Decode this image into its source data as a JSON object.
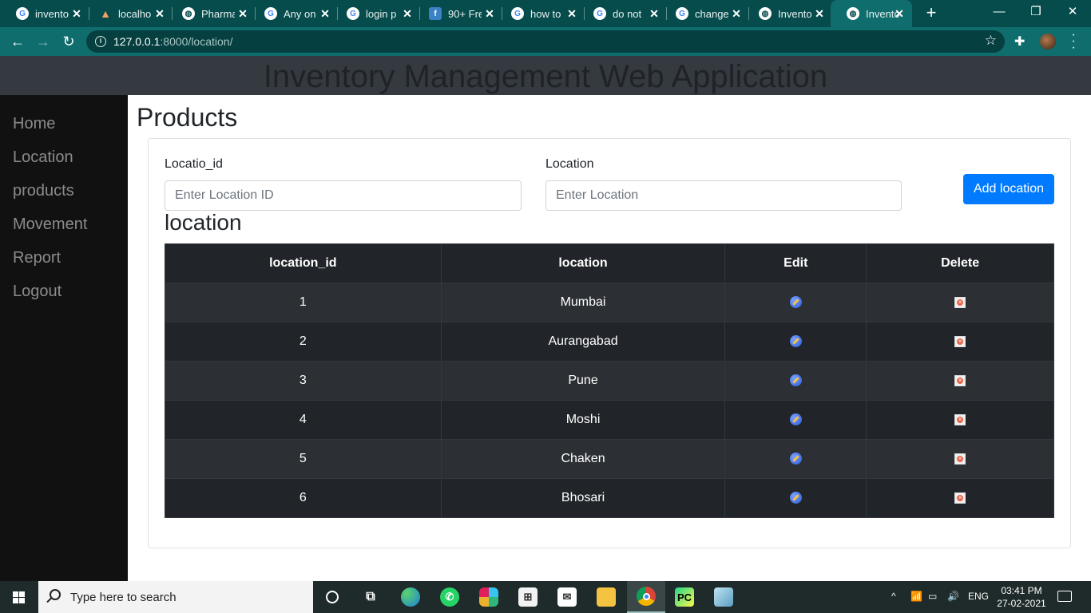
{
  "browser": {
    "tabs": [
      {
        "title": "invento",
        "icon": "google-icon"
      },
      {
        "title": "localho",
        "icon": "xampp-icon"
      },
      {
        "title": "Pharma",
        "icon": "globe-icon"
      },
      {
        "title": "Any on",
        "icon": "google-icon"
      },
      {
        "title": "login p",
        "icon": "google-icon"
      },
      {
        "title": "90+ Fre",
        "icon": "f-icon"
      },
      {
        "title": "how to",
        "icon": "google-icon"
      },
      {
        "title": "do not",
        "icon": "google-icon"
      },
      {
        "title": "change",
        "icon": "google-icon"
      },
      {
        "title": "Invento",
        "icon": "globe-icon"
      },
      {
        "title": "Invento",
        "icon": "globe-icon",
        "active": true
      }
    ],
    "url_host": "127.0.0.1",
    "url_path": ":8000/location/",
    "new_tab_glyph": "+",
    "tab_close_glyph": "✕"
  },
  "app": {
    "header_title": "Inventory Management Web Application",
    "nav": [
      "Home",
      "Location",
      "products",
      "Movement",
      "Report",
      "Logout"
    ],
    "page_title": "Products",
    "form": {
      "id_label": "Locatio_id",
      "id_placeholder": "Enter Location ID",
      "location_label": "Location",
      "location_placeholder": "Enter Location",
      "add_button": "Add location"
    },
    "section_title": "location",
    "table": {
      "headers": [
        "location_id",
        "location",
        "Edit",
        "Delete"
      ],
      "rows": [
        {
          "id": "1",
          "location": "Mumbai"
        },
        {
          "id": "2",
          "location": "Aurangabad"
        },
        {
          "id": "3",
          "location": "Pune"
        },
        {
          "id": "4",
          "location": "Moshi"
        },
        {
          "id": "5",
          "location": "Chaken"
        },
        {
          "id": "6",
          "location": "Bhosari"
        }
      ]
    }
  },
  "taskbar": {
    "search_placeholder": "Type here to search",
    "language": "ENG",
    "time": "03:41 PM",
    "date": "27-02-2021"
  },
  "colors": {
    "chrome_frame": "#074c4c",
    "chrome_toolbar": "#0f6d6d",
    "header_bg": "#343a40",
    "sidebar_bg": "#111111",
    "primary_button": "#007bff",
    "table_dark": "#212529",
    "table_striped": "#2c3034"
  }
}
